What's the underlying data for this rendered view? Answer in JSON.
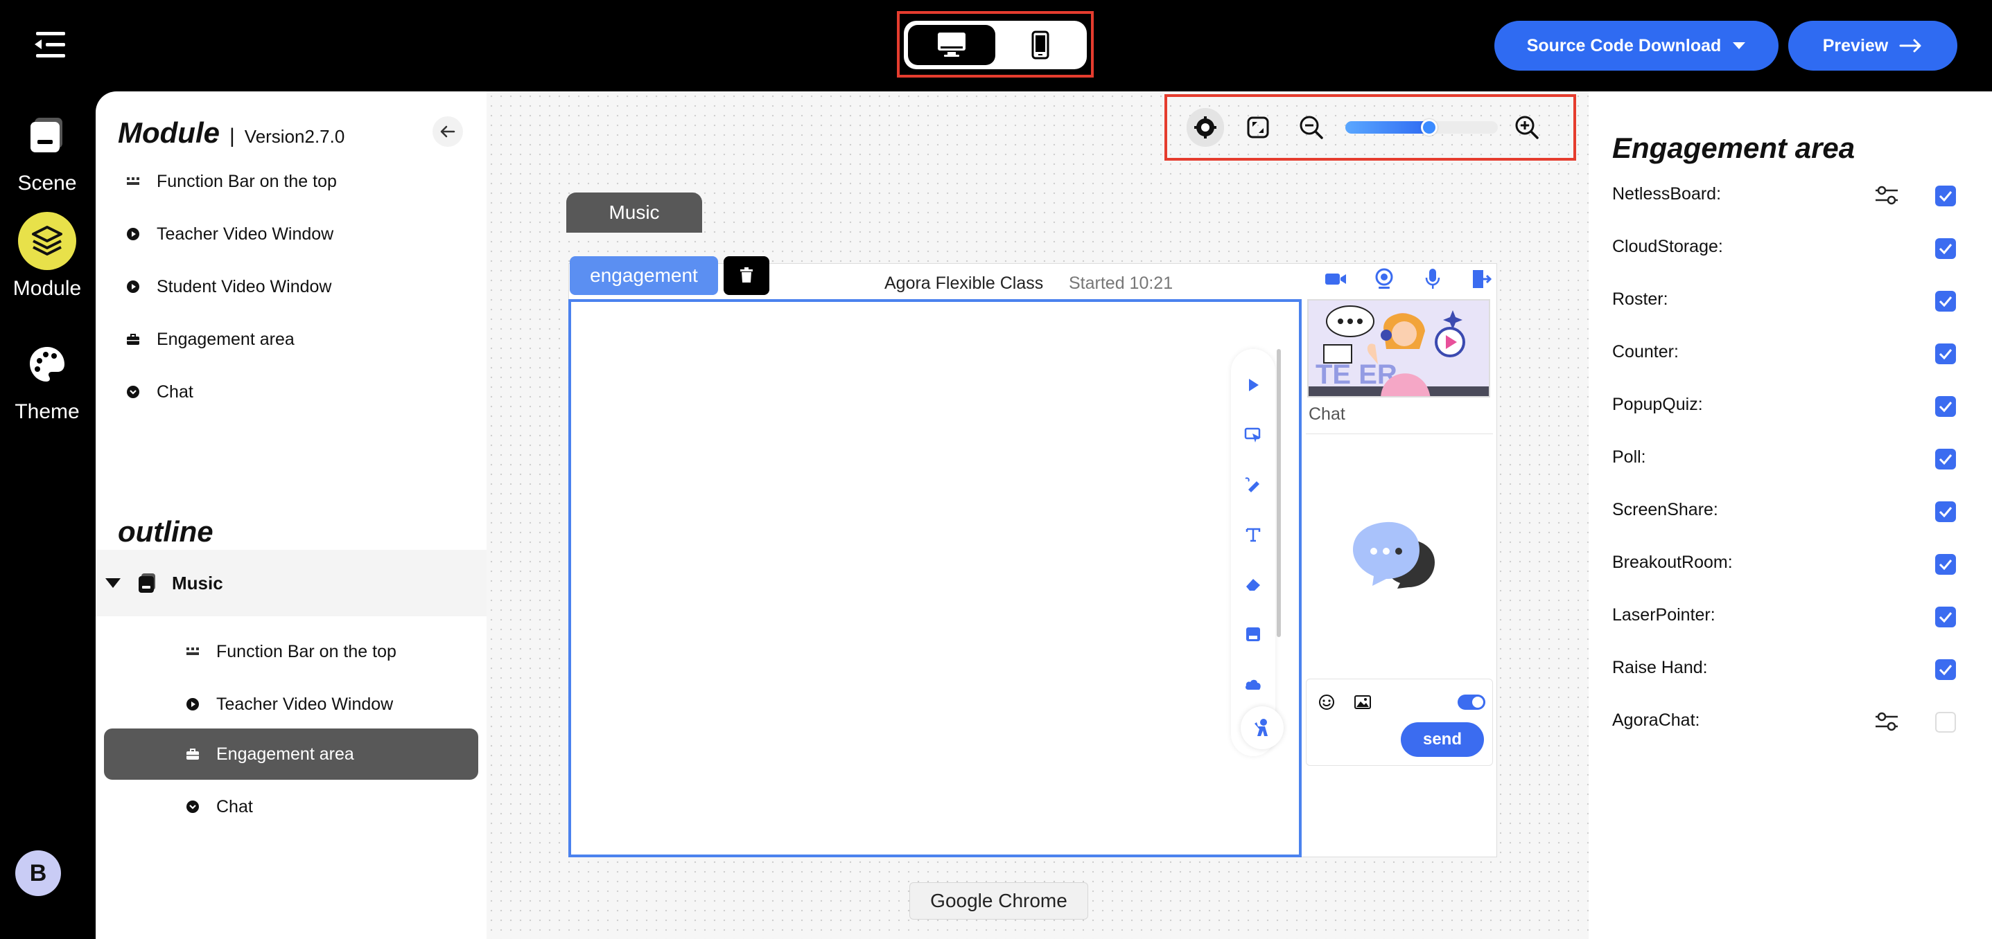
{
  "header": {
    "download_label": "Source Code Download",
    "preview_label": "Preview"
  },
  "rail": {
    "scene_label": "Scene",
    "module_label": "Module",
    "theme_label": "Theme",
    "avatar_letter": "B"
  },
  "module_panel": {
    "title": "Module",
    "separator": "|",
    "version": "Version2.7.0",
    "items": [
      {
        "label": "Function Bar on the top",
        "icon": "grid-icon"
      },
      {
        "label": "Teacher Video Window",
        "icon": "play-circle-icon"
      },
      {
        "label": "Student Video Window",
        "icon": "play-circle-icon"
      },
      {
        "label": "Engagement area",
        "icon": "briefcase-icon"
      },
      {
        "label": "Chat",
        "icon": "chevron-circle-icon"
      }
    ]
  },
  "outline": {
    "title": "outline",
    "root_label": "Music",
    "items": [
      {
        "label": "Function Bar on the top",
        "active": false
      },
      {
        "label": "Teacher Video Window",
        "active": false
      },
      {
        "label": "Engagement area",
        "active": true
      },
      {
        "label": "Chat",
        "active": false
      }
    ]
  },
  "canvas": {
    "zoom_level_fraction": 0.55,
    "scene_tab_label": "Music",
    "engagement_tag": "engagement",
    "class_title": "Agora Flexible Class",
    "class_started": "Started 10:21",
    "chat_label": "Chat",
    "send_label": "send",
    "tooltip": "Google Chrome"
  },
  "engagement_panel": {
    "title": "Engagement area",
    "rows": [
      {
        "label": "NetlessBoard:",
        "has_settings": true,
        "checked": true
      },
      {
        "label": "CloudStorage:",
        "has_settings": false,
        "checked": true
      },
      {
        "label": "Roster:",
        "has_settings": false,
        "checked": true
      },
      {
        "label": "Counter:",
        "has_settings": false,
        "checked": true
      },
      {
        "label": "PopupQuiz:",
        "has_settings": false,
        "checked": true
      },
      {
        "label": "Poll:",
        "has_settings": false,
        "checked": true
      },
      {
        "label": "ScreenShare:",
        "has_settings": false,
        "checked": true
      },
      {
        "label": "BreakoutRoom:",
        "has_settings": false,
        "checked": true
      },
      {
        "label": "LaserPointer:",
        "has_settings": false,
        "checked": true
      },
      {
        "label": "Raise Hand:",
        "has_settings": false,
        "checked": true
      },
      {
        "label": "AgoraChat:",
        "has_settings": true,
        "checked": false
      }
    ]
  },
  "colors": {
    "accent": "#2f6bf2",
    "module_highlight": "#e8e14a",
    "focus_outline": "#e53c2e",
    "active_item": "#585858"
  }
}
